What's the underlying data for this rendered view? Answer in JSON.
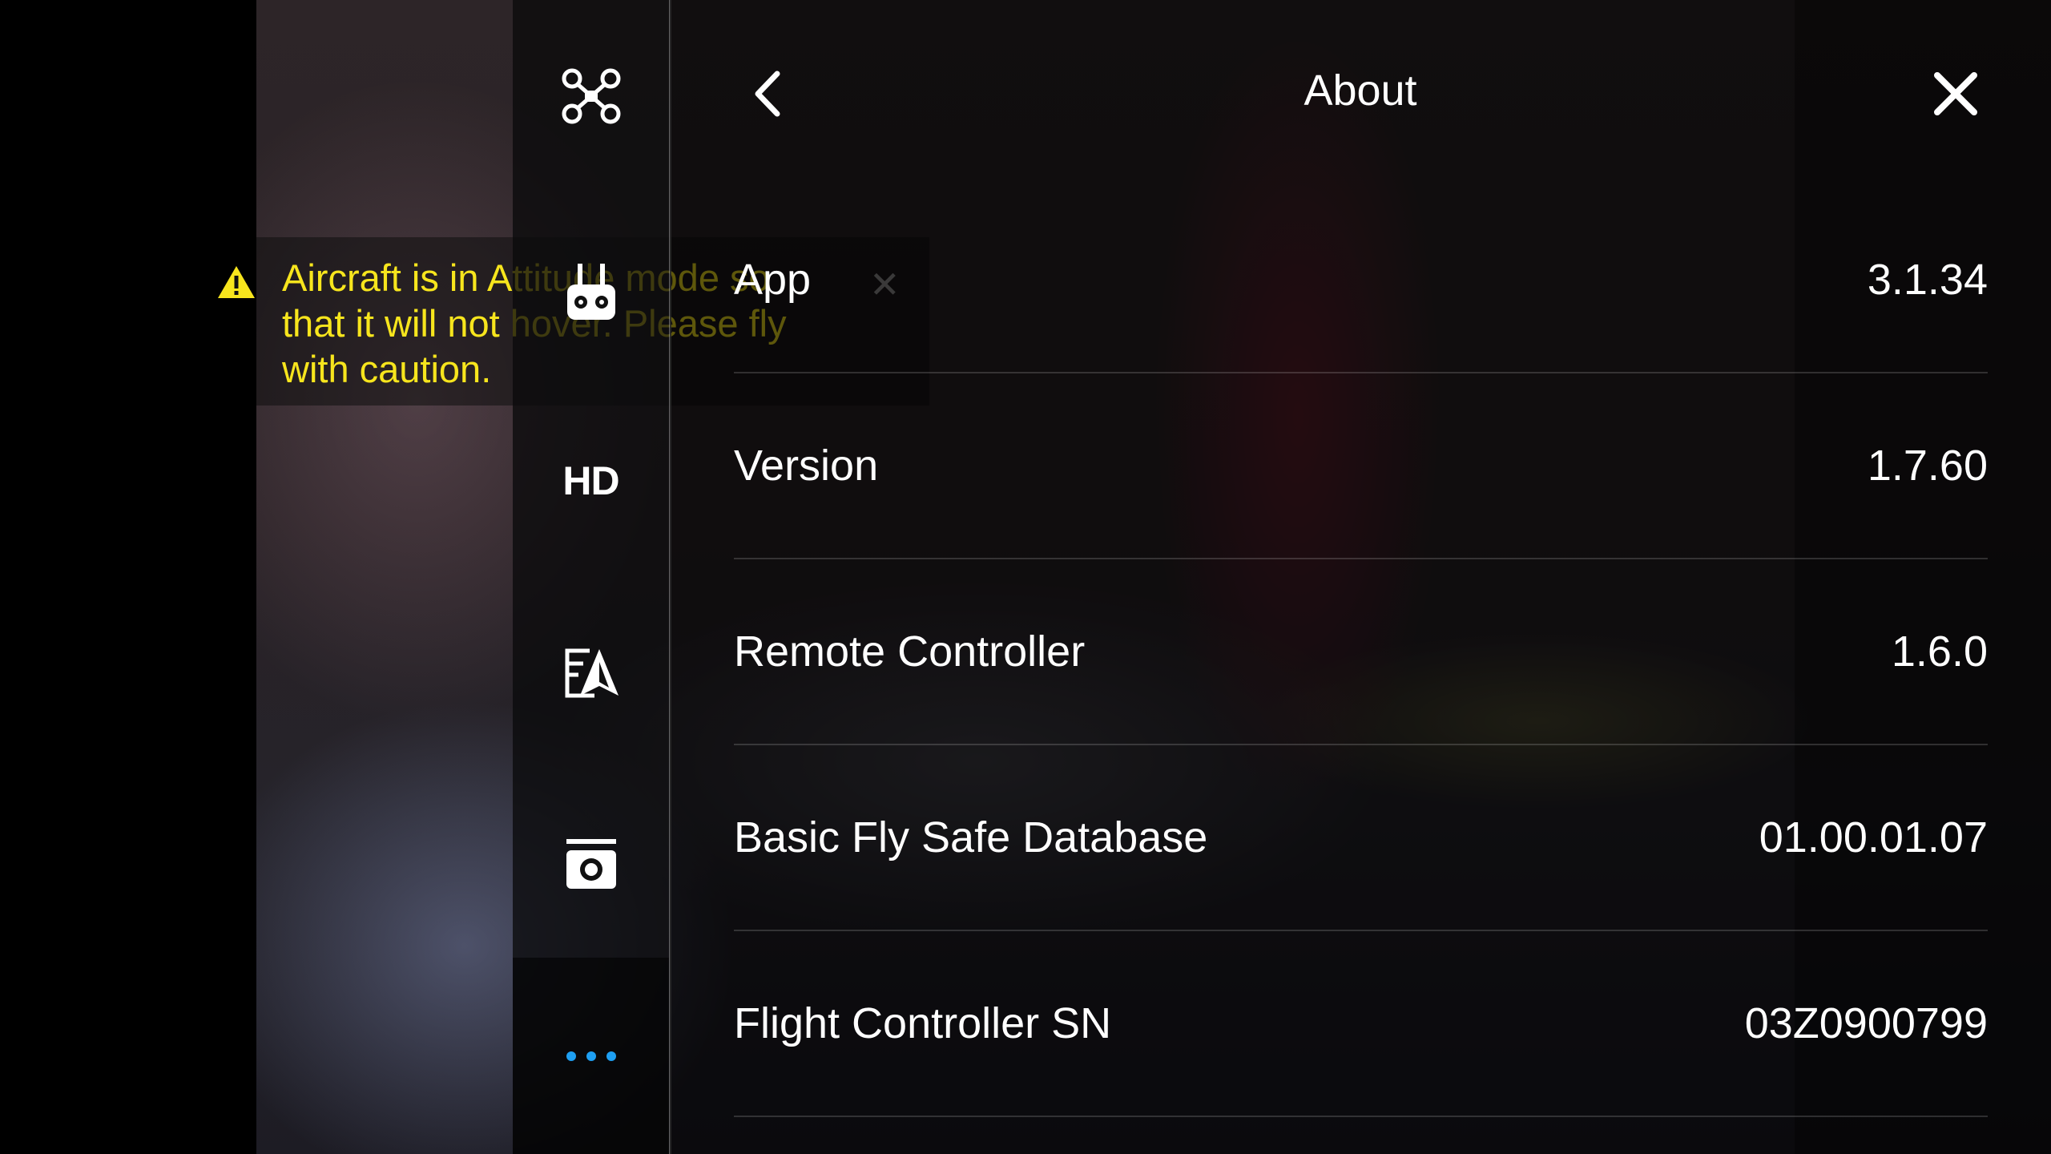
{
  "warning": {
    "message": "Aircraft is in Attitude mode so that it will not hover. Please fly with caution."
  },
  "rail": {
    "hd_label": "HD"
  },
  "panel": {
    "title": "About",
    "rows": [
      {
        "label": "App",
        "value": "3.1.34"
      },
      {
        "label": "Version",
        "value": "1.7.60"
      },
      {
        "label": "Remote Controller",
        "value": "1.6.0"
      },
      {
        "label": "Basic Fly Safe Database",
        "value": "01.00.01.07"
      },
      {
        "label": "Flight Controller SN",
        "value": "03Z0900799"
      }
    ]
  },
  "colors": {
    "warning_text": "#f7e51d",
    "accent_dots": "#1e9ff2"
  }
}
